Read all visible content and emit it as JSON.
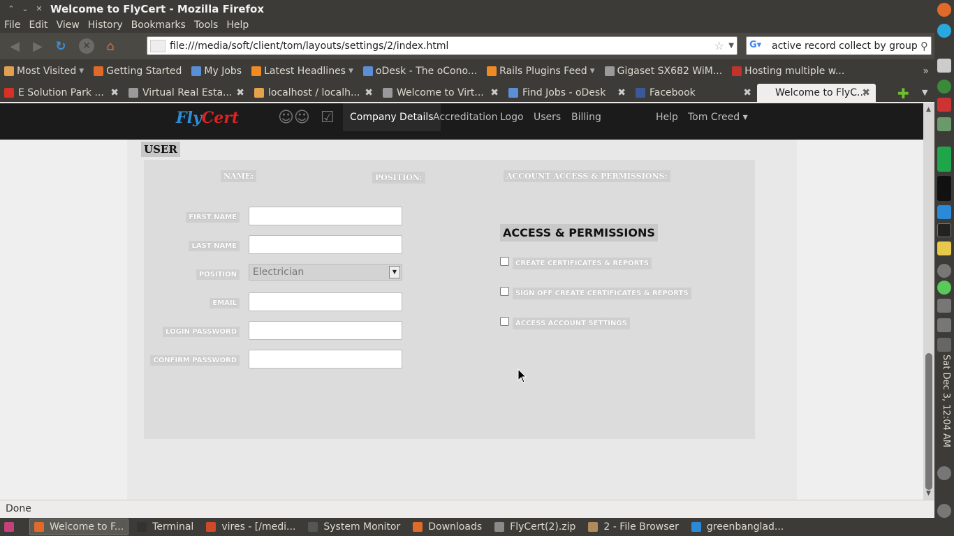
{
  "window": {
    "title": "Welcome to FlyCert - Mozilla Firefox"
  },
  "menu": [
    "File",
    "Edit",
    "View",
    "History",
    "Bookmarks",
    "Tools",
    "Help"
  ],
  "url": "file:///media/soft/client/tom/layouts/settings/2/index.html",
  "search": {
    "value": "active record collect by group"
  },
  "bookmarks": [
    {
      "label": "Most Visited",
      "dropdown": true,
      "color": "#e0a050"
    },
    {
      "label": "Getting Started",
      "dropdown": false,
      "color": "#e06a2a"
    },
    {
      "label": "My Jobs",
      "dropdown": false,
      "color": "#5a8fd8"
    },
    {
      "label": "Latest Headlines",
      "dropdown": true,
      "color": "#f08a24"
    },
    {
      "label": "oDesk - The oCono...",
      "dropdown": false,
      "color": "#5a8fd8"
    },
    {
      "label": "Rails Plugins Feed",
      "dropdown": true,
      "color": "#f08a24"
    },
    {
      "label": "Gigaset SX682 WiM...",
      "dropdown": false,
      "color": "#9a9a9a"
    },
    {
      "label": "Hosting multiple w...",
      "dropdown": false,
      "color": "#c0332a"
    }
  ],
  "tabs": [
    {
      "label": "E Solution Park ...",
      "color": "#d93025",
      "active": false
    },
    {
      "label": "Virtual Real Esta...",
      "color": "#9a9a9a",
      "active": false
    },
    {
      "label": "localhost / localh...",
      "color": "#e4a24a",
      "active": false
    },
    {
      "label": "Welcome to Virt...",
      "color": "#9a9a9a",
      "active": false
    },
    {
      "label": "Find Jobs - oDesk",
      "color": "#5a8fd8",
      "active": false
    },
    {
      "label": "Facebook",
      "color": "#3b5998",
      "active": false
    },
    {
      "label": "Welcome to FlyC...",
      "color": "#eeeeee",
      "active": true
    }
  ],
  "app": {
    "logo": {
      "fly": "Fly",
      "cert": "Cert"
    },
    "nav": [
      "Company Details",
      "Accreditation",
      "Logo",
      "Users",
      "Billing"
    ],
    "help": "Help",
    "user": "Tom Creed"
  },
  "form": {
    "section": "USER",
    "headers": {
      "name": "NAME:",
      "position": "POSITION:",
      "account": "ACCOUNT ACCESS & PERMISSIONS:"
    },
    "fields": {
      "first_name": {
        "label": "FIRST NAME",
        "value": ""
      },
      "last_name": {
        "label": "LAST NAME",
        "value": ""
      },
      "position": {
        "label": "POSITION",
        "value": "Electrician"
      },
      "email": {
        "label": "EMAIL",
        "value": ""
      },
      "login_password": {
        "label": "LOGIN PASSWORD",
        "value": ""
      },
      "confirm_password": {
        "label": "CONFIRM PASSWORD",
        "value": ""
      }
    },
    "permissions_title": "ACCESS & PERMISSIONS",
    "permissions": [
      {
        "label": "CREATE CERTIFICATES & REPORTS",
        "checked": false
      },
      {
        "label": "SIGN OFF CREATE CERTIFICATES & REPORTS",
        "checked": false
      },
      {
        "label": "ACCESS ACCOUNT SETTINGS",
        "checked": false
      }
    ]
  },
  "status": "Done",
  "clock": "Sat Dec  3, 12:04 AM",
  "taskbar": [
    {
      "label": "Welcome to F...",
      "active": true,
      "color": "#e06a2a"
    },
    {
      "label": "Terminal",
      "active": false,
      "color": "#333333"
    },
    {
      "label": "vires - [/medi...",
      "active": false,
      "color": "#d04a2a"
    },
    {
      "label": "System Monitor",
      "active": false,
      "color": "#555555"
    },
    {
      "label": "Downloads",
      "active": false,
      "color": "#e06a2a"
    },
    {
      "label": "FlyCert(2).zip",
      "active": false,
      "color": "#8a8a8a"
    },
    {
      "label": "2 - File Browser",
      "active": false,
      "color": "#b08a5a"
    },
    {
      "label": "greenbanglad...",
      "active": false,
      "color": "#2a8ad8"
    }
  ]
}
